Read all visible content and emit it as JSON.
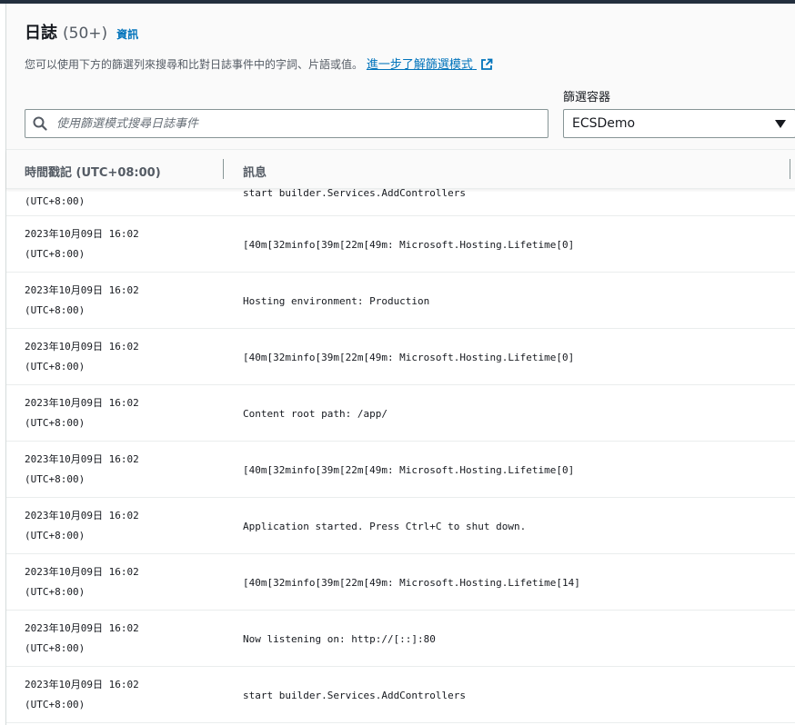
{
  "header": {
    "title": "日誌",
    "count": "(50+)",
    "info_link": "資訊",
    "description": "您可以使用下方的篩選列來搜尋和比對日誌事件中的字詞、片語或值。",
    "learn_more": "進一步了解篩選模式"
  },
  "search": {
    "placeholder": "使用篩選模式搜尋日誌事件",
    "value": ""
  },
  "filter": {
    "label": "篩選容器",
    "selected": "ECSDemo"
  },
  "table": {
    "columns": {
      "timestamp": "時間戳記 (UTC+08:00)",
      "message": "訊息"
    },
    "partial_row": {
      "tz": "(UTC+8:00)",
      "message": "start builder.Services.AddControllers"
    },
    "rows": [
      {
        "date": "2023年10月09日 16:02",
        "tz": "(UTC+8:00)",
        "message": "[40m[32minfo[39m[22m[49m: Microsoft.Hosting.Lifetime[0]"
      },
      {
        "date": "2023年10月09日 16:02",
        "tz": "(UTC+8:00)",
        "message": "Hosting environment: Production"
      },
      {
        "date": "2023年10月09日 16:02",
        "tz": "(UTC+8:00)",
        "message": "[40m[32minfo[39m[22m[49m: Microsoft.Hosting.Lifetime[0]"
      },
      {
        "date": "2023年10月09日 16:02",
        "tz": "(UTC+8:00)",
        "message": "Content root path: /app/"
      },
      {
        "date": "2023年10月09日 16:02",
        "tz": "(UTC+8:00)",
        "message": "[40m[32minfo[39m[22m[49m: Microsoft.Hosting.Lifetime[0]"
      },
      {
        "date": "2023年10月09日 16:02",
        "tz": "(UTC+8:00)",
        "message": "Application started. Press Ctrl+C to shut down."
      },
      {
        "date": "2023年10月09日 16:02",
        "tz": "(UTC+8:00)",
        "message": "[40m[32minfo[39m[22m[49m: Microsoft.Hosting.Lifetime[14]"
      },
      {
        "date": "2023年10月09日 16:02",
        "tz": "(UTC+8:00)",
        "message": "Now listening on: http://[::]:80"
      },
      {
        "date": "2023年10月09日 16:02",
        "tz": "(UTC+8:00)",
        "message": "start builder.Services.AddControllers"
      }
    ]
  },
  "icons": {
    "search": "search-icon",
    "external_link": "external-link-icon",
    "caret": "caret-down-icon"
  },
  "colors": {
    "link": "#0073bb",
    "text": "#16191f",
    "muted": "#545b64"
  }
}
